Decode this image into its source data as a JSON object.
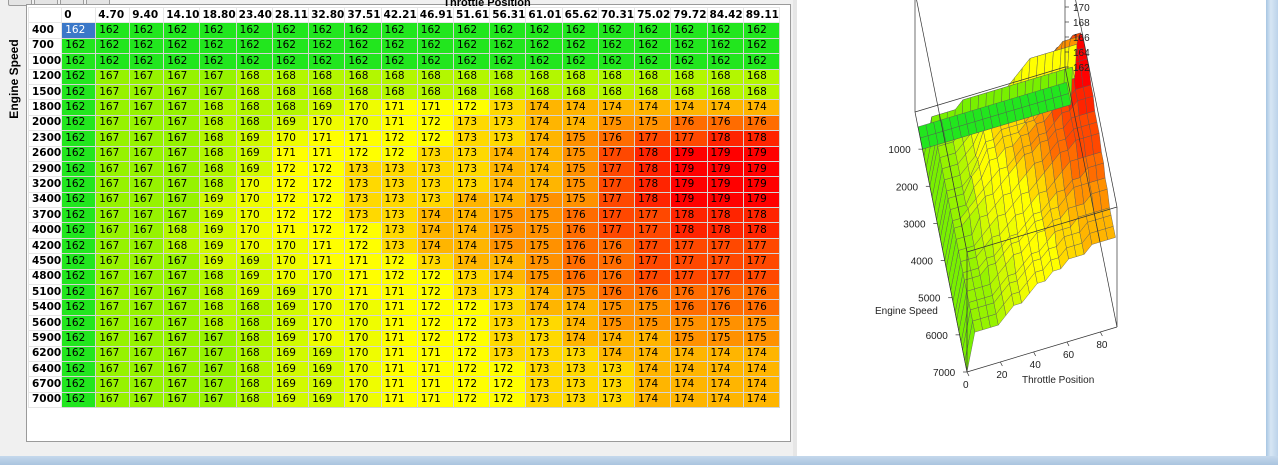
{
  "axis_title_x": "Throttle Position",
  "table": {
    "row_header_title": "Engine Speed",
    "columns": [
      "0",
      "4.70",
      "9.40",
      "14.10",
      "18.80",
      "23.40",
      "28.11",
      "32.80",
      "37.51",
      "42.21",
      "46.91",
      "51.61",
      "56.31",
      "61.01",
      "65.62",
      "70.31",
      "75.02",
      "79.72",
      "84.42",
      "89.11"
    ],
    "rows": [
      {
        "rpm": "400",
        "values": [
          162,
          162,
          162,
          162,
          162,
          162,
          162,
          162,
          162,
          162,
          162,
          162,
          162,
          162,
          162,
          162,
          162,
          162,
          162,
          162
        ]
      },
      {
        "rpm": "700",
        "values": [
          162,
          162,
          162,
          162,
          162,
          162,
          162,
          162,
          162,
          162,
          162,
          162,
          162,
          162,
          162,
          162,
          162,
          162,
          162,
          162
        ]
      },
      {
        "rpm": "1000",
        "values": [
          162,
          162,
          162,
          162,
          162,
          162,
          162,
          162,
          162,
          162,
          162,
          162,
          162,
          162,
          162,
          162,
          162,
          162,
          162,
          162
        ]
      },
      {
        "rpm": "1200",
        "values": [
          162,
          167,
          167,
          167,
          167,
          168,
          168,
          168,
          168,
          168,
          168,
          168,
          168,
          168,
          168,
          168,
          168,
          168,
          168,
          168
        ]
      },
      {
        "rpm": "1500",
        "values": [
          162,
          167,
          167,
          167,
          167,
          168,
          168,
          168,
          168,
          168,
          168,
          168,
          168,
          168,
          168,
          168,
          168,
          168,
          168,
          168
        ]
      },
      {
        "rpm": "1800",
        "values": [
          162,
          167,
          167,
          167,
          168,
          168,
          168,
          169,
          170,
          171,
          171,
          172,
          173,
          174,
          174,
          174,
          174,
          174,
          174,
          174
        ]
      },
      {
        "rpm": "2000",
        "values": [
          162,
          167,
          167,
          167,
          168,
          168,
          169,
          170,
          170,
          171,
          172,
          173,
          173,
          174,
          174,
          175,
          175,
          176,
          176,
          176
        ]
      },
      {
        "rpm": "2300",
        "values": [
          162,
          167,
          167,
          167,
          168,
          169,
          170,
          171,
          171,
          172,
          172,
          173,
          173,
          174,
          175,
          176,
          177,
          177,
          178,
          178
        ]
      },
      {
        "rpm": "2600",
        "values": [
          162,
          167,
          167,
          167,
          168,
          169,
          171,
          171,
          172,
          172,
          173,
          173,
          174,
          174,
          175,
          177,
          178,
          179,
          179,
          179
        ]
      },
      {
        "rpm": "2900",
        "values": [
          162,
          167,
          167,
          167,
          168,
          169,
          172,
          172,
          173,
          173,
          173,
          173,
          174,
          174,
          175,
          177,
          178,
          179,
          179,
          179
        ]
      },
      {
        "rpm": "3200",
        "values": [
          162,
          167,
          167,
          167,
          168,
          170,
          172,
          172,
          173,
          173,
          173,
          173,
          174,
          174,
          175,
          177,
          178,
          179,
          179,
          179
        ]
      },
      {
        "rpm": "3400",
        "values": [
          162,
          167,
          167,
          167,
          169,
          170,
          172,
          172,
          173,
          173,
          173,
          174,
          174,
          175,
          175,
          177,
          178,
          179,
          179,
          179
        ]
      },
      {
        "rpm": "3700",
        "values": [
          162,
          167,
          167,
          167,
          169,
          170,
          172,
          172,
          173,
          173,
          174,
          174,
          175,
          175,
          176,
          177,
          177,
          178,
          178,
          178
        ]
      },
      {
        "rpm": "4000",
        "values": [
          162,
          167,
          167,
          168,
          169,
          170,
          171,
          172,
          172,
          173,
          174,
          174,
          175,
          175,
          176,
          177,
          177,
          178,
          178,
          178
        ]
      },
      {
        "rpm": "4200",
        "values": [
          162,
          167,
          167,
          168,
          169,
          170,
          170,
          171,
          172,
          173,
          174,
          174,
          175,
          175,
          176,
          176,
          177,
          177,
          177,
          177
        ]
      },
      {
        "rpm": "4500",
        "values": [
          162,
          167,
          167,
          167,
          169,
          169,
          170,
          171,
          171,
          172,
          173,
          174,
          174,
          175,
          176,
          176,
          177,
          177,
          177,
          177
        ]
      },
      {
        "rpm": "4800",
        "values": [
          162,
          167,
          167,
          167,
          168,
          169,
          170,
          170,
          171,
          172,
          172,
          173,
          174,
          175,
          176,
          176,
          177,
          177,
          177,
          177
        ]
      },
      {
        "rpm": "5100",
        "values": [
          162,
          167,
          167,
          167,
          168,
          169,
          169,
          170,
          171,
          171,
          172,
          173,
          173,
          174,
          175,
          176,
          176,
          176,
          176,
          176
        ]
      },
      {
        "rpm": "5400",
        "values": [
          162,
          167,
          167,
          167,
          168,
          168,
          169,
          170,
          170,
          171,
          172,
          172,
          173,
          174,
          174,
          175,
          175,
          176,
          176,
          176
        ]
      },
      {
        "rpm": "5600",
        "values": [
          162,
          167,
          167,
          167,
          168,
          168,
          169,
          170,
          170,
          171,
          172,
          172,
          173,
          173,
          174,
          175,
          175,
          175,
          175,
          175
        ]
      },
      {
        "rpm": "5900",
        "values": [
          162,
          167,
          167,
          167,
          167,
          168,
          169,
          170,
          170,
          171,
          172,
          172,
          173,
          173,
          174,
          174,
          174,
          175,
          175,
          175
        ]
      },
      {
        "rpm": "6200",
        "values": [
          162,
          167,
          167,
          167,
          167,
          168,
          169,
          169,
          170,
          171,
          171,
          172,
          173,
          173,
          173,
          174,
          174,
          174,
          174,
          174
        ]
      },
      {
        "rpm": "6400",
        "values": [
          162,
          167,
          167,
          167,
          167,
          168,
          169,
          169,
          170,
          171,
          171,
          172,
          172,
          173,
          173,
          173,
          174,
          174,
          174,
          174
        ]
      },
      {
        "rpm": "6700",
        "values": [
          162,
          167,
          167,
          167,
          167,
          168,
          169,
          169,
          170,
          171,
          171,
          172,
          172,
          173,
          173,
          173,
          174,
          174,
          174,
          174
        ]
      },
      {
        "rpm": "7000",
        "values": [
          162,
          167,
          167,
          167,
          167,
          168,
          169,
          169,
          170,
          171,
          171,
          172,
          172,
          173,
          173,
          173,
          174,
          174,
          174,
          174
        ]
      }
    ],
    "selected_cell": "162"
  },
  "plot": {
    "ylabel": "Engine Speed",
    "xlabel": "Throttle Position",
    "y_ticks": [
      "1000",
      "2000",
      "3000",
      "4000",
      "5000",
      "6000",
      "7000"
    ],
    "x_ticks": [
      "0",
      "20",
      "40",
      "60",
      "80"
    ],
    "z_ticks": [
      "178",
      "176",
      "174",
      "172",
      "170",
      "168",
      "166",
      "164",
      "162"
    ]
  },
  "colors": {
    "low": "#1ee01e",
    "mid": "#ffff00",
    "high": "#ff0000",
    "selected": "#3b78c8"
  }
}
